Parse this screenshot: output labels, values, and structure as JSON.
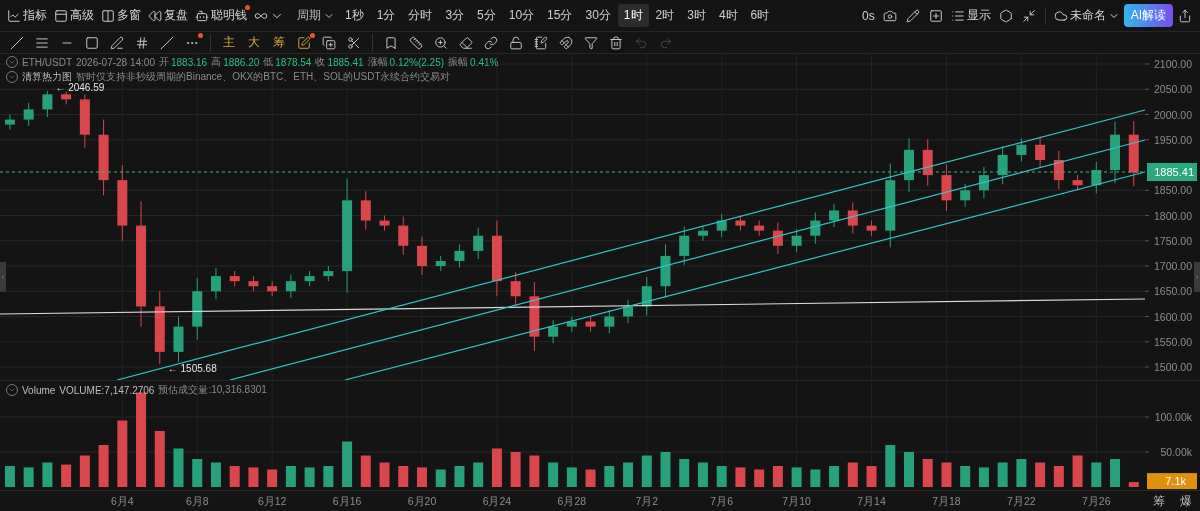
{
  "toolbar": {
    "menus": [
      {
        "label": "指标"
      },
      {
        "label": "高级"
      },
      {
        "label": "多窗"
      },
      {
        "label": "复盘"
      },
      {
        "label": "聪明钱",
        "dot": true
      }
    ],
    "period_menu": "周期",
    "intervals": [
      {
        "label": "1秒",
        "selected": false
      },
      {
        "label": "1分",
        "selected": false
      },
      {
        "label": "分时",
        "selected": false
      },
      {
        "label": "3分",
        "selected": false
      },
      {
        "label": "5分",
        "selected": false
      },
      {
        "label": "10分",
        "selected": false
      },
      {
        "label": "15分",
        "selected": false
      },
      {
        "label": "30分",
        "selected": false
      },
      {
        "label": "1时",
        "selected": true
      },
      {
        "label": "2时",
        "selected": false
      },
      {
        "label": "3时",
        "selected": false
      },
      {
        "label": "4时",
        "selected": false
      },
      {
        "label": "6时",
        "selected": false
      }
    ],
    "countdown": "0s",
    "display_menu": "显示",
    "layout_name": "未命名",
    "ai_button": "AI解读"
  },
  "drawing_toolbar": {
    "more_dot": true,
    "text_tools": [
      {
        "label": "主"
      },
      {
        "label": "大"
      },
      {
        "label": "筹"
      }
    ],
    "edit_dot": true,
    "undo_disabled": true,
    "redo_disabled": true
  },
  "legend": {
    "symbol": "ETH/USDT",
    "time": "2026-07-28 14:00",
    "fields": [
      {
        "label": "开",
        "value": "1883.16"
      },
      {
        "label": "高",
        "value": "1886.20"
      },
      {
        "label": "低",
        "value": "1878.54"
      },
      {
        "label": "收",
        "value": "1885.41"
      },
      {
        "label": "涨幅",
        "value": "0.12%(2.25)"
      },
      {
        "label": "振幅",
        "value": "0.41%"
      }
    ]
  },
  "heatmap": {
    "title": "清算热力图",
    "note": "智时仅支持非秒级周期的Binance、OKX的BTC、ETH、SOL的USDT永续合约交易对"
  },
  "price_chart": {
    "last_price": "1885.41",
    "chart_data": {
      "type": "candlestick",
      "grid": true,
      "categories": [
        null,
        null,
        null,
        null,
        null,
        null,
        null,
        null,
        null,
        null,
        null,
        null,
        null,
        null,
        null,
        null,
        null,
        null,
        null,
        null,
        null,
        null,
        null,
        null,
        null,
        null,
        null,
        null,
        null,
        null,
        null,
        null,
        null,
        null,
        null,
        null,
        null,
        null,
        null,
        null,
        null,
        null,
        null,
        null,
        null,
        null,
        null,
        null,
        null,
        null,
        null,
        null,
        null,
        null,
        null,
        null,
        null,
        null,
        null,
        null,
        null
      ],
      "ohlc": [
        [
          1980,
          2000,
          1970,
          1990
        ],
        [
          1990,
          2023,
          1977,
          2010
        ],
        [
          2010,
          2046.59,
          1995,
          2040
        ],
        [
          2040,
          2045,
          2020,
          2030
        ],
        [
          2030,
          2040,
          1934,
          1960
        ],
        [
          1960,
          1990,
          1840,
          1870
        ],
        [
          1870,
          1900,
          1750,
          1780
        ],
        [
          1780,
          1828,
          1580,
          1620
        ],
        [
          1620,
          1650,
          1505.68,
          1530
        ],
        [
          1530,
          1600,
          1510,
          1580
        ],
        [
          1580,
          1676,
          1554,
          1650
        ],
        [
          1650,
          1696,
          1634,
          1680
        ],
        [
          1680,
          1690,
          1660,
          1670
        ],
        [
          1670,
          1680,
          1650,
          1660
        ],
        [
          1660,
          1670,
          1640,
          1650
        ],
        [
          1650,
          1683,
          1637,
          1670
        ],
        [
          1670,
          1690,
          1660,
          1680
        ],
        [
          1680,
          1700,
          1670,
          1690
        ],
        [
          1690,
          1873,
          1647,
          1830
        ],
        [
          1830,
          1848,
          1772,
          1790
        ],
        [
          1790,
          1800,
          1770,
          1780
        ],
        [
          1780,
          1798,
          1722,
          1740
        ],
        [
          1740,
          1758,
          1682,
          1700
        ],
        [
          1700,
          1720,
          1690,
          1710
        ],
        [
          1710,
          1743,
          1697,
          1730
        ],
        [
          1730,
          1776,
          1714,
          1760
        ],
        [
          1760,
          1790,
          1640,
          1670
        ],
        [
          1670,
          1688,
          1622,
          1640
        ],
        [
          1640,
          1668,
          1532,
          1560
        ],
        [
          1560,
          1593,
          1547,
          1580
        ],
        [
          1580,
          1600,
          1570,
          1590
        ],
        [
          1590,
          1600,
          1570,
          1580
        ],
        [
          1580,
          1613,
          1567,
          1600
        ],
        [
          1600,
          1633,
          1587,
          1620
        ],
        [
          1620,
          1678,
          1602,
          1660
        ],
        [
          1660,
          1743,
          1637,
          1720
        ],
        [
          1720,
          1778,
          1702,
          1760
        ],
        [
          1760,
          1780,
          1750,
          1770
        ],
        [
          1770,
          1803,
          1757,
          1790
        ],
        [
          1790,
          1800,
          1770,
          1780
        ],
        [
          1780,
          1790,
          1760,
          1770
        ],
        [
          1770,
          1786,
          1724,
          1740
        ],
        [
          1740,
          1773,
          1727,
          1760
        ],
        [
          1760,
          1806,
          1744,
          1790
        ],
        [
          1790,
          1823,
          1777,
          1810
        ],
        [
          1810,
          1826,
          1764,
          1780
        ],
        [
          1780,
          1790,
          1760,
          1770
        ],
        [
          1770,
          1903,
          1737,
          1870
        ],
        [
          1870,
          1953,
          1847,
          1930
        ],
        [
          1930,
          1951,
          1859,
          1880
        ],
        [
          1880,
          1901,
          1809,
          1830
        ],
        [
          1830,
          1863,
          1817,
          1850
        ],
        [
          1850,
          1896,
          1834,
          1880
        ],
        [
          1880,
          1938,
          1862,
          1920
        ],
        [
          1920,
          1953,
          1907,
          1940
        ],
        [
          1940,
          1956,
          1894,
          1910
        ],
        [
          1910,
          1928,
          1852,
          1870
        ],
        [
          1870,
          1880,
          1850,
          1860
        ],
        [
          1860,
          1906,
          1844,
          1890
        ],
        [
          1890,
          1986,
          1864,
          1960
        ],
        [
          1960,
          1987,
          1858,
          1885
        ]
      ],
      "ylim": [
        1474.3,
        2119.8
      ],
      "yticks": [
        {
          "value": 2100,
          "label": "2100.00"
        },
        {
          "value": 2050,
          "label": "2050.00"
        },
        {
          "value": 2000,
          "label": "2000.00"
        },
        {
          "value": 1950,
          "label": "1950.00"
        },
        {
          "value": 1850,
          "label": "1850.00"
        },
        {
          "value": 1800,
          "label": "1800.00"
        },
        {
          "value": 1750,
          "label": "1750.00"
        },
        {
          "value": 1700,
          "label": "1700.00"
        },
        {
          "value": 1650,
          "label": "1650.00"
        },
        {
          "value": 1600,
          "label": "1600.00"
        },
        {
          "value": 1550,
          "label": "1550.00"
        },
        {
          "value": 1500,
          "label": "1500.00"
        }
      ],
      "annotations": [
        "← 2046.59",
        "← 1505.68"
      ]
    }
  },
  "volume_chart": {
    "title": "Volume",
    "reading": "VOLUME:7,147.2706",
    "estimate": "预估成交量:10,316.8301",
    "last_volume": "7.1k",
    "chart_data": {
      "type": "bar",
      "grid": true,
      "categories": [
        null,
        null,
        null,
        null,
        null,
        null,
        "6月4",
        null,
        null,
        null,
        "6月8",
        null,
        null,
        null,
        "6月12",
        null,
        null,
        null,
        "6月16",
        null,
        null,
        null,
        "6月20",
        null,
        null,
        null,
        "6月24",
        null,
        null,
        null,
        "6月28",
        null,
        null,
        null,
        "7月2",
        null,
        null,
        null,
        "7月6",
        null,
        null,
        null,
        "7月10",
        null,
        null,
        null,
        "7月14",
        null,
        null,
        null,
        "7月18",
        null,
        null,
        null,
        "7月22",
        null,
        null,
        null,
        "7月26",
        null,
        null
      ],
      "ylim": [
        0,
        152.86
      ],
      "values": [
        30,
        28,
        35,
        32,
        45,
        60,
        95,
        135,
        80,
        55,
        40,
        35,
        30,
        28,
        25,
        30,
        28,
        30,
        65,
        45,
        35,
        30,
        28,
        25,
        30,
        35,
        55,
        50,
        45,
        35,
        28,
        25,
        30,
        35,
        45,
        50,
        40,
        35,
        30,
        28,
        25,
        30,
        28,
        25,
        30,
        35,
        30,
        60,
        50,
        40,
        35,
        30,
        28,
        35,
        40,
        35,
        30,
        45,
        35,
        40,
        7
      ],
      "yticks": [
        {
          "value": 100,
          "label": "100.00k"
        },
        {
          "value": 50,
          "label": "50.00k"
        }
      ]
    }
  },
  "corner_labels": [
    "筹",
    "爆"
  ]
}
